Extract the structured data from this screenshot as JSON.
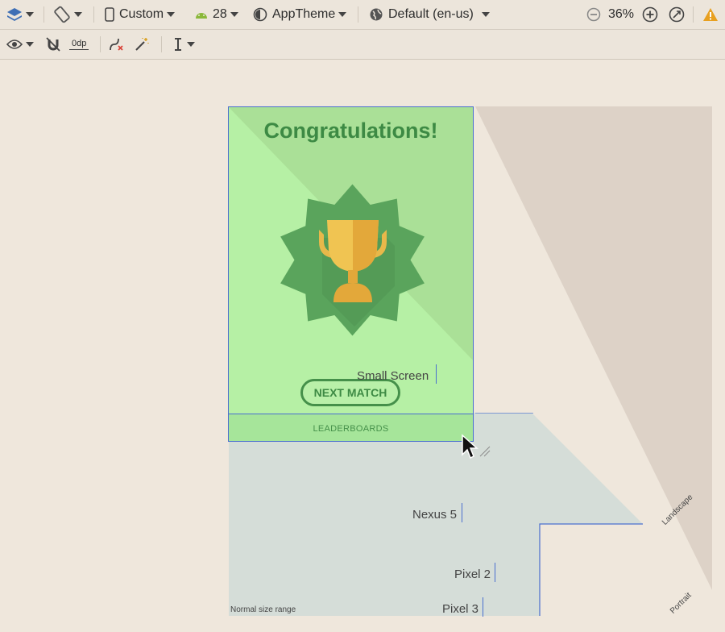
{
  "toolbar": {
    "device": "Custom",
    "api_level": "28",
    "theme": "AppTheme",
    "locale": "Default (en-us)",
    "zoom": "36%",
    "margin": "0dp"
  },
  "design": {
    "title": "Congratulations!",
    "next_match": "NEXT MATCH",
    "leaderboards": "LEADERBOARDS"
  },
  "size_labels": {
    "small_screen": "Small Screen",
    "nexus5": "Nexus 5",
    "pixel2": "Pixel 2",
    "pixel3": "Pixel 3",
    "normal_range": "Normal size range",
    "landscape": "Landscape",
    "portrait": "Portrait"
  },
  "colors": {
    "screen_bg": "#b6f0a5",
    "accent_green": "#3d8a44",
    "selection_blue": "#4a6fcf",
    "trophy_gold": "#e8b84a",
    "warning": "#e8a020"
  }
}
